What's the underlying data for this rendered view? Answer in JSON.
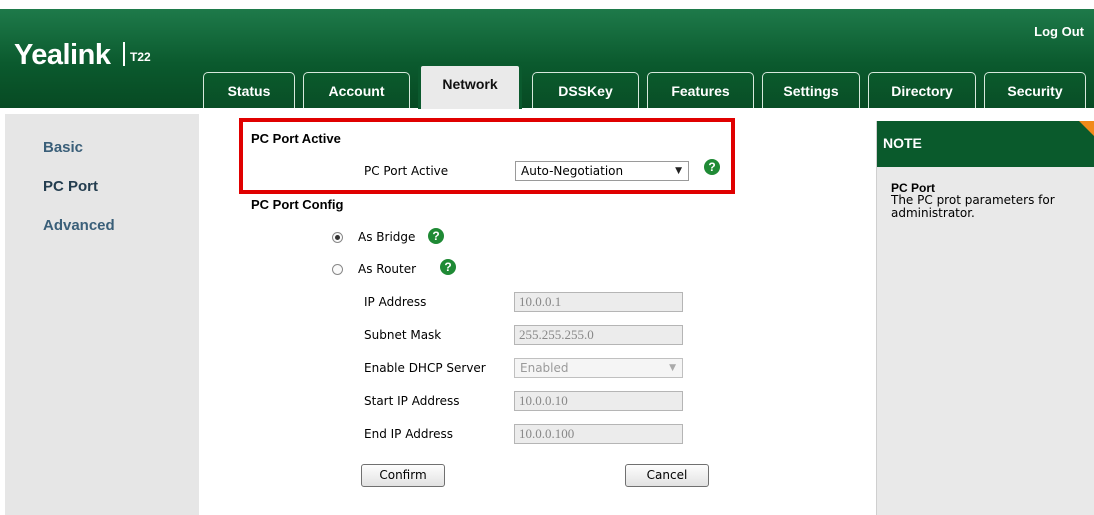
{
  "header": {
    "logo": "Yealink",
    "model": "T22",
    "logout_label": "Log Out",
    "tabs": [
      {
        "label": "Status"
      },
      {
        "label": "Account"
      },
      {
        "label": "Network",
        "active": true
      },
      {
        "label": "DSSKey"
      },
      {
        "label": "Features"
      },
      {
        "label": "Settings"
      },
      {
        "label": "Directory"
      },
      {
        "label": "Security"
      }
    ]
  },
  "sidebar": {
    "items": [
      {
        "label": "Basic"
      },
      {
        "label": "PC Port",
        "active": true
      },
      {
        "label": "Advanced"
      }
    ]
  },
  "main": {
    "pc_port_active_section": "PC Port Active",
    "pc_port_active_label": "PC Port Active",
    "pc_port_active_value": "Auto-Negotiation",
    "pc_port_config_section": "PC Port Config",
    "as_bridge_label": "As Bridge",
    "as_bridge_checked": true,
    "as_router_label": "As Router",
    "as_router_checked": false,
    "fields": {
      "ip_label": "IP Address",
      "ip_value": "10.0.0.1",
      "subnet_label": "Subnet Mask",
      "subnet_value": "255.255.255.0",
      "dhcp_label": "Enable DHCP Server",
      "dhcp_value": "Enabled",
      "start_label": "Start IP Address",
      "start_value": "10.0.0.10",
      "end_label": "End IP Address",
      "end_value": "10.0.0.100"
    },
    "confirm_label": "Confirm",
    "cancel_label": "Cancel",
    "help_glyph": "?"
  },
  "note": {
    "title": "NOTE",
    "subtitle": "PC Port",
    "text": "The PC prot parameters for administrator."
  },
  "colors": {
    "header_green": "#0b5a2e",
    "help_green": "#1f8a35",
    "highlight_red": "#e00000",
    "note_corner": "#f28a1a"
  }
}
